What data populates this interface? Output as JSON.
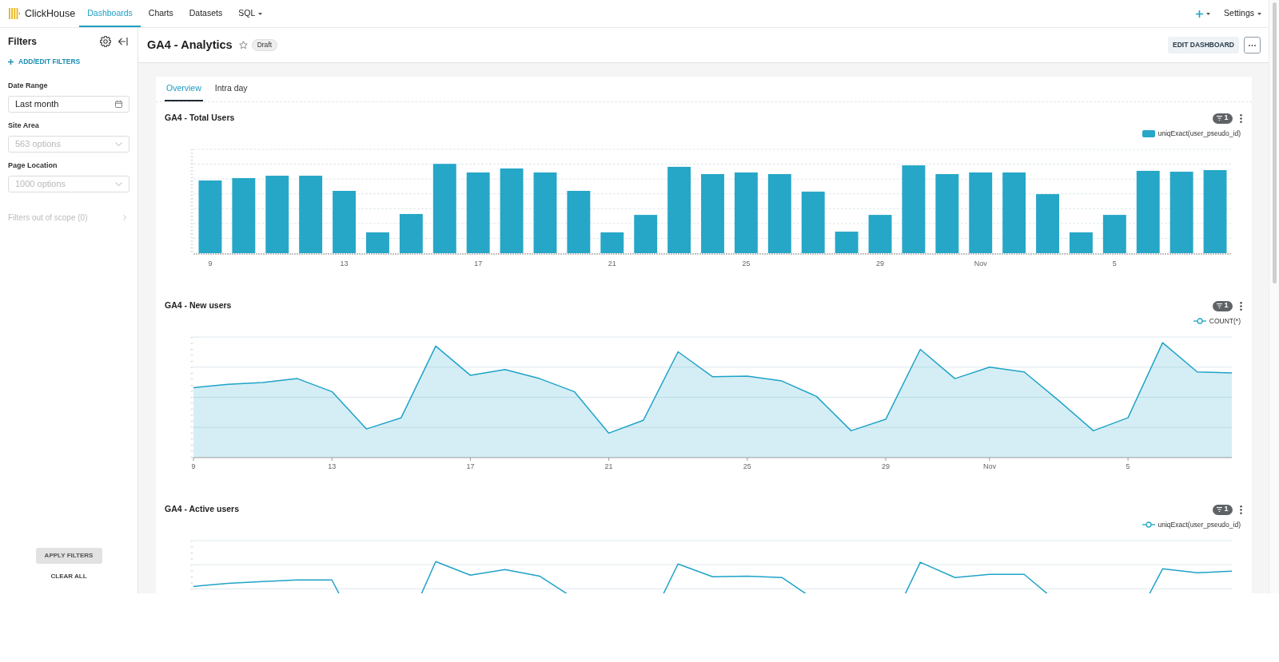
{
  "top_nav": {
    "logo": "ClickHouse",
    "tabs": [
      {
        "label": "Dashboards",
        "selected": true,
        "has_menu": false
      },
      {
        "label": "Charts",
        "selected": false,
        "has_menu": false
      },
      {
        "label": "Datasets",
        "selected": false,
        "has_menu": false
      },
      {
        "label": "SQL",
        "selected": false,
        "has_menu": true
      }
    ],
    "settings": "Settings"
  },
  "sidebar": {
    "title": "Filters",
    "add_filters": "ADD/EDIT FILTERS",
    "filters": [
      {
        "kind": "date",
        "label": "Date Range",
        "value": "Last month"
      },
      {
        "kind": "select",
        "label": "Site Area",
        "placeholder": "563 options"
      },
      {
        "kind": "select",
        "label": "Page Location",
        "placeholder": "1000 options"
      }
    ],
    "out_of_scope": "Filters out of scope (0)",
    "apply_button": "APPLY FILTERS",
    "clear_button": "CLEAR ALL"
  },
  "dashboard": {
    "title": "GA4 - Analytics",
    "starred": false,
    "status": "Draft",
    "edit_button": "EDIT DASHBOARD",
    "tabs": [
      {
        "label": "Overview",
        "selected": true
      },
      {
        "label": "Intra day",
        "selected": false
      }
    ],
    "charts": [
      {
        "kind": "bar",
        "title": "GA4 - Total Users",
        "filter_count": "1",
        "legend": "uniqExact(user_pseudo_id)",
        "axis_labels": [
          "9",
          "13",
          "17",
          "21",
          "25",
          "29",
          "Nov",
          "5"
        ]
      },
      {
        "kind": "area",
        "title": "GA4 - New users",
        "filter_count": "1",
        "legend": "COUNT(*)",
        "axis_labels": [
          "9",
          "13",
          "17",
          "21",
          "25",
          "29",
          "Nov",
          "5"
        ]
      },
      {
        "kind": "line",
        "title": "GA4 - Active users",
        "filter_count": "1",
        "legend": "uniqExact(user_pseudo_id)"
      }
    ]
  }
}
